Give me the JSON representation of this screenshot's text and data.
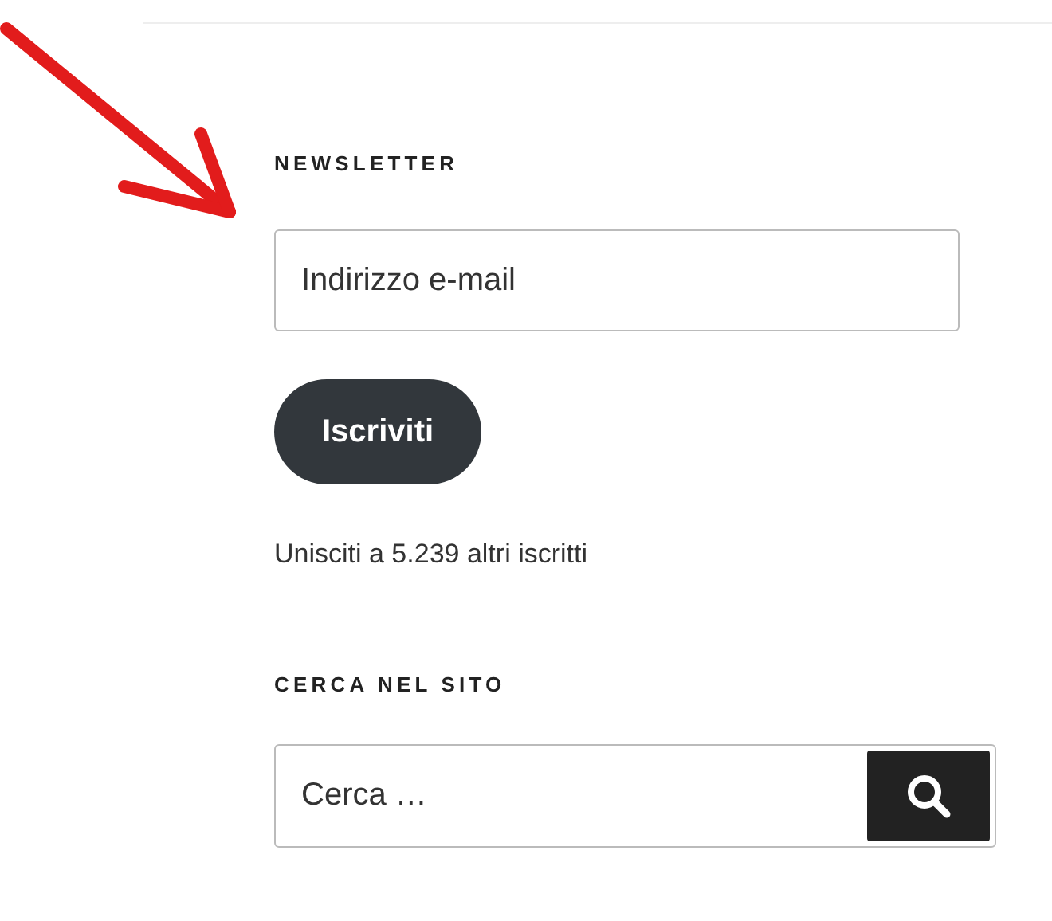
{
  "newsletter": {
    "heading": "NEWSLETTER",
    "email_placeholder": "Indirizzo e-mail",
    "subscribe_button": "Iscriviti",
    "subscribers_note": "Unisciti a 5.239 altri iscritti"
  },
  "search": {
    "heading": "CERCA NEL SITO",
    "placeholder": "Cerca …"
  }
}
